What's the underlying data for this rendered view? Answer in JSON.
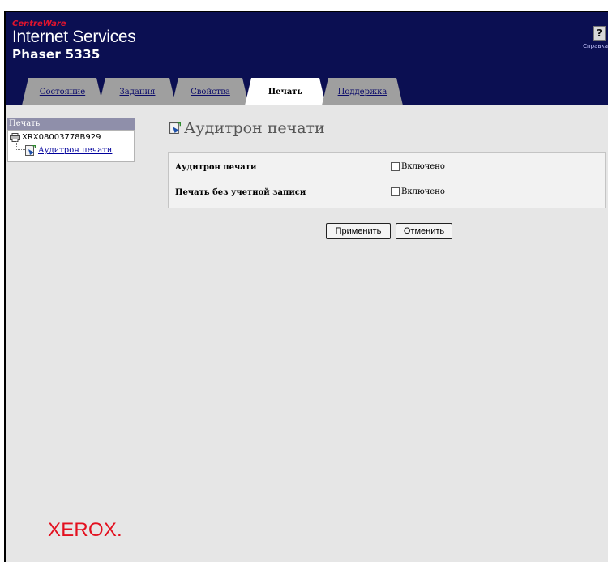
{
  "header": {
    "brand_small": "CentreWare",
    "brand_main": "Internet Services",
    "model": "Phaser 5335",
    "help_label": "Справка",
    "help_glyph": "?"
  },
  "tabs": [
    {
      "label": "Состояние",
      "active": false
    },
    {
      "label": "Задания",
      "active": false
    },
    {
      "label": "Свойства",
      "active": false
    },
    {
      "label": "Печать",
      "active": true
    },
    {
      "label": "Поддержка",
      "active": false
    }
  ],
  "sidebar": {
    "header": "Печать",
    "root_item": "XRX08003778B929",
    "child_item": "Аудитрон печати"
  },
  "main": {
    "title": "Аудитрон печати",
    "rows": [
      {
        "label": "Аудитрон печати",
        "checkbox_label": "Включено",
        "checked": false
      },
      {
        "label": "Печать без учетной записи",
        "checkbox_label": "Включено",
        "checked": false
      }
    ],
    "apply_button": "Применить",
    "cancel_button": "Отменить"
  },
  "footer": {
    "logo": "XEROX."
  },
  "colors": {
    "header_bg": "#0b0f52",
    "brand_accent": "#e0142e",
    "xerox_red": "#e3101f",
    "sidebar_header_bg": "#8f8faa"
  }
}
